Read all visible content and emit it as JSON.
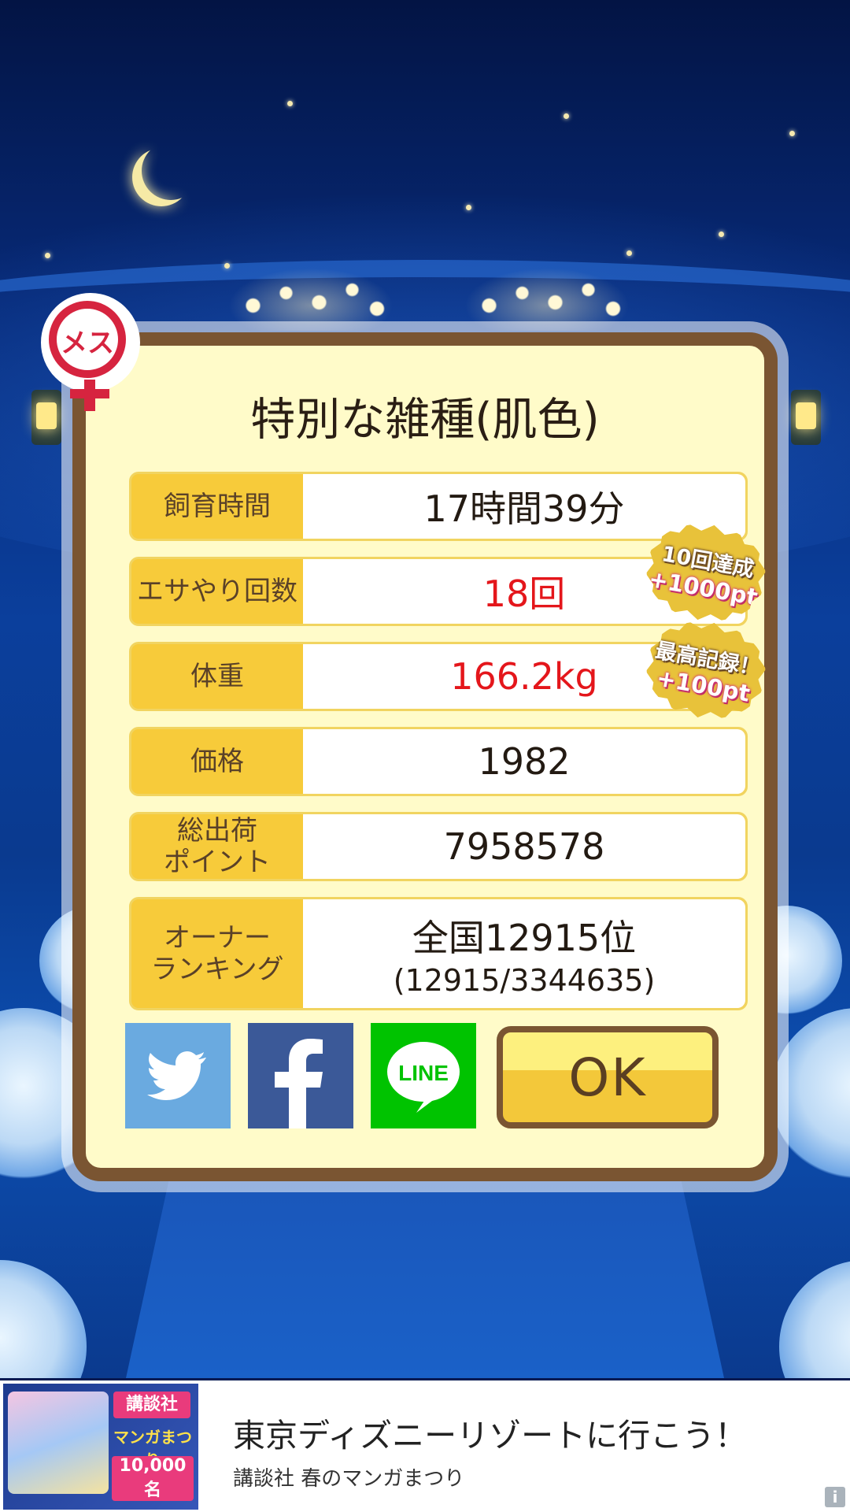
{
  "badge": {
    "label": "メス"
  },
  "dialog": {
    "title": "特別な雑種(肌色)",
    "rows": [
      {
        "label": "飼育時間",
        "value": "17時間39分",
        "highlight": false
      },
      {
        "label": "エサやり回数",
        "value": "18回",
        "highlight": true
      },
      {
        "label": "体重",
        "value": "166.2kg",
        "highlight": true
      },
      {
        "label": "価格",
        "value": "1982",
        "highlight": false
      },
      {
        "label_line1": "総出荷",
        "label_line2": "ポイント",
        "value": "7958578",
        "highlight": false
      },
      {
        "label_line1": "オーナー",
        "label_line2": "ランキング",
        "value": "全国12915位",
        "value_sub": "(12915/3344635)",
        "highlight": false
      }
    ],
    "awards": [
      {
        "title": "10回達成",
        "points": "+1000pt"
      },
      {
        "title": "最高記録！",
        "points": "+100pt"
      }
    ],
    "share": {
      "twitter_icon": "twitter-bird-icon",
      "facebook_icon": "facebook-f-icon",
      "line_label": "LINE"
    },
    "ok_label": "OK"
  },
  "colors": {
    "accent_red": "#e4161b",
    "frame_brown": "#7a5532",
    "label_yellow": "#f7cb3a",
    "panel_cream": "#fffbc9"
  },
  "ad": {
    "title": "東京ディズニーリゾートに行こう！",
    "subtitle": "講談社 春のマンガまつり",
    "image_publisher": "講談社",
    "image_campaign": "マンガまつり",
    "image_prize": "10,000名",
    "info_icon": "i"
  }
}
